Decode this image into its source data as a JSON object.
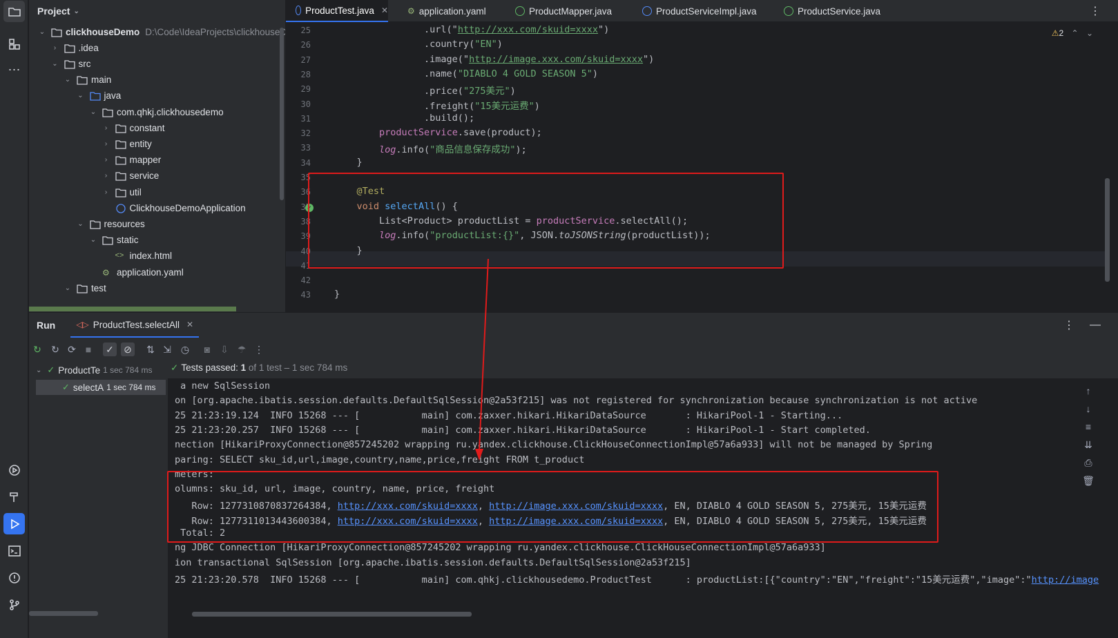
{
  "project_panel": {
    "title": "Project",
    "tree": [
      {
        "label": "clickhouseDemo",
        "path": "D:\\Code\\IdeaProjects\\clickhouseD",
        "level": 0,
        "open": true,
        "bold": true
      },
      {
        "label": ".idea",
        "level": 1,
        "open": false
      },
      {
        "label": "src",
        "level": 1,
        "open": true
      },
      {
        "label": "main",
        "level": 2,
        "open": true
      },
      {
        "label": "java",
        "level": 3,
        "open": true
      },
      {
        "label": "com.qhkj.clickhousedemo",
        "level": 4,
        "open": true
      },
      {
        "label": "constant",
        "level": 5,
        "open": false
      },
      {
        "label": "entity",
        "level": 5,
        "open": false
      },
      {
        "label": "mapper",
        "level": 5,
        "open": false
      },
      {
        "label": "service",
        "level": 5,
        "open": false
      },
      {
        "label": "util",
        "level": 5,
        "open": false
      },
      {
        "label": "ClickhouseDemoApplication",
        "level": 5,
        "leaf": true
      },
      {
        "label": "resources",
        "level": 3,
        "open": true
      },
      {
        "label": "static",
        "level": 4,
        "open": true
      },
      {
        "label": "index.html",
        "level": 5,
        "leaf": true
      },
      {
        "label": "application.yaml",
        "level": 4,
        "leaf": true
      },
      {
        "label": "test",
        "level": 2,
        "open": true
      }
    ]
  },
  "editor_tabs": [
    {
      "label": "ProductTest.java",
      "active": true,
      "icon": "class-icon"
    },
    {
      "label": "application.yaml",
      "active": false,
      "icon": "yaml-icon"
    },
    {
      "label": "ProductMapper.java",
      "active": false,
      "icon": "interface-icon"
    },
    {
      "label": "ProductServiceImpl.java",
      "active": false,
      "icon": "class-icon"
    },
    {
      "label": "ProductService.java",
      "active": false,
      "icon": "interface-icon"
    }
  ],
  "editor": {
    "warnings": "2",
    "lines": [
      {
        "n": "25",
        "html": "                .url(\"<span class='url'>http://xxx.com/skuid=xxxx</span>\")"
      },
      {
        "n": "26",
        "html": "                .country(<span class='str'>\"EN\"</span>)"
      },
      {
        "n": "27",
        "html": "                .image(\"<span class='url'>http://image.xxx.com/skuid=xxxx</span>\")"
      },
      {
        "n": "28",
        "html": "                .name(<span class='str'>\"DIABLO 4 GOLD SEASON 5\"</span>)"
      },
      {
        "n": "29",
        "html": "                .price(<span class='str'>\"275美元\"</span>)"
      },
      {
        "n": "30",
        "html": "                .freight(<span class='str'>\"15美元运费\"</span>)"
      },
      {
        "n": "31",
        "html": "                .build();"
      },
      {
        "n": "32",
        "html": "        <span class='fld'>productService</span>.save(product);"
      },
      {
        "n": "33",
        "html": "        <span class='fld it'>log</span>.info(<span class='str'>\"商品信息保存成功\"</span>);"
      },
      {
        "n": "34",
        "html": "    }"
      },
      {
        "n": "35",
        "html": ""
      },
      {
        "n": "36",
        "html": "    <span class='ann'>@Test</span>"
      },
      {
        "n": "37",
        "html": "    <span class='kw'>void</span> <span class='fn'>selectAll</span>() {"
      },
      {
        "n": "38",
        "html": "        List&lt;Product&gt; productList = <span class='fld'>productService</span>.selectAll();"
      },
      {
        "n": "39",
        "html": "        <span class='fld it'>log</span>.info(<span class='str'>\"productList:{}\"</span>, JSON.<span class='it'>toJSONString</span>(productList));"
      },
      {
        "n": "40",
        "html": "    }"
      },
      {
        "n": "41",
        "html": ""
      },
      {
        "n": "42",
        "html": ""
      },
      {
        "n": "43",
        "html": "}"
      }
    ]
  },
  "run_panel": {
    "label": "Run",
    "tab": "ProductTest.selectAll",
    "tree_root": "ProductTe",
    "tree_root_time": "1 sec 784 ms",
    "tree_child": "selectA",
    "tree_child_time": "1 sec 784 ms",
    "status_prefix": "Tests passed: ",
    "status_count": "1",
    "status_suffix": " of 1 test – 1 sec 784 ms",
    "console": [
      " a new SqlSession",
      "on [org.apache.ibatis.session.defaults.DefaultSqlSession@2a53f215] was not registered for synchronization because synchronization is not active",
      "25 21:23:19.124  INFO 15268 --- [           main] com.zaxxer.hikari.HikariDataSource       : HikariPool-1 - Starting...",
      "25 21:23:20.257  INFO 15268 --- [           main] com.zaxxer.hikari.HikariDataSource       : HikariPool-1 - Start completed.",
      "nection [HikariProxyConnection@857245202 wrapping ru.yandex.clickhouse.ClickHouseConnectionImpl@57a6a933] will not be managed by Spring",
      "paring: SELECT sku_id,url,image,country,name,price,freight FROM t_product",
      "meters: ",
      "olumns: sku_id, url, image, country, name, price, freight",
      "   Row: 1277310870837264384, <a class='curl'>http://xxx.com/skuid=xxxx</a>, <a class='curl'>http://image.xxx.com/skuid=xxxx</a>, EN, DIABLO 4 GOLD SEASON 5, 275美元, 15美元运费",
      "   Row: 1277311013443600384, <a class='curl'>http://xxx.com/skuid=xxxx</a>, <a class='curl'>http://image.xxx.com/skuid=xxxx</a>, EN, DIABLO 4 GOLD SEASON 5, 275美元, 15美元运费",
      " Total: 2",
      "ng JDBC Connection [HikariProxyConnection@857245202 wrapping ru.yandex.clickhouse.ClickHouseConnectionImpl@57a6a933]",
      "ion transactional SqlSession [org.apache.ibatis.session.defaults.DefaultSqlSession@2a53f215]",
      "25 21:23:20.578  INFO 15268 --- [           main] com.qhkj.clickhousedemo.ProductTest      : productList:[{\"country\":\"EN\",\"freight\":\"15美元运费\",\"image\":\"<a class='curl'>http://image</a>"
    ]
  },
  "colors": {
    "accent": "#3574f0",
    "annotation_red": "#e01b1b",
    "pass_green": "#5fb865"
  }
}
